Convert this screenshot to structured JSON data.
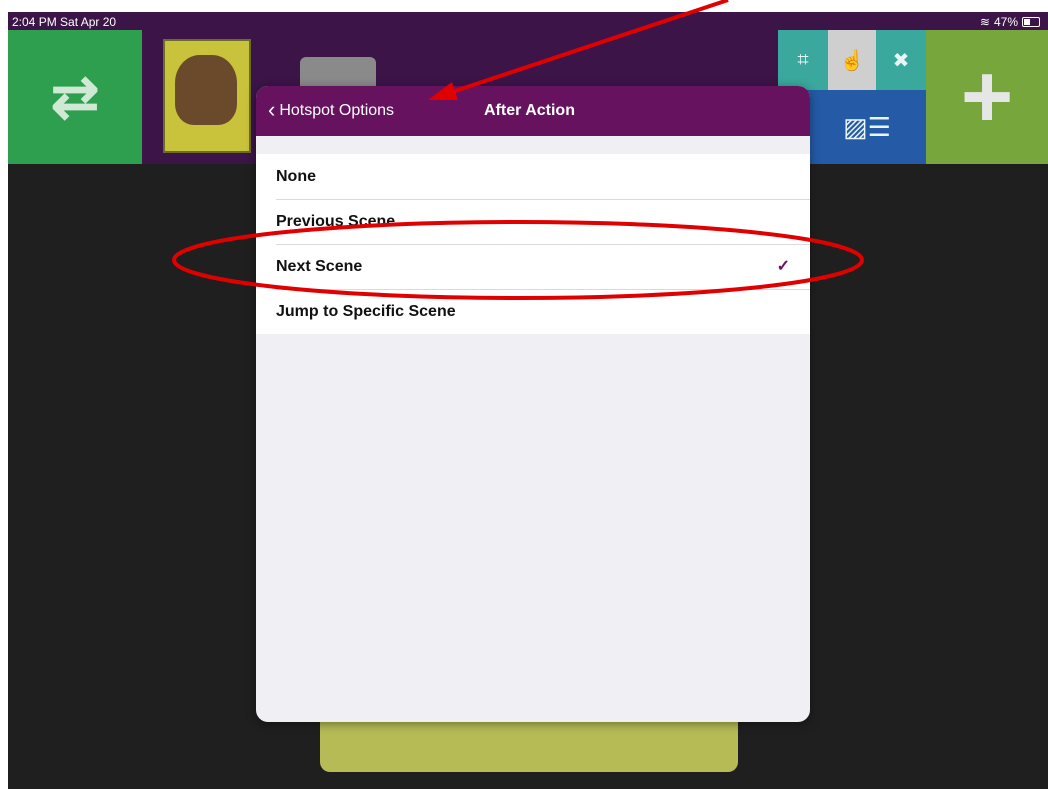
{
  "status_bar": {
    "time": "2:04 PM  Sat Apr 20",
    "battery": "47%",
    "wifi_icon": "wifi-icon"
  },
  "dialog": {
    "back_label": "Hotspot Options",
    "title": "After Action",
    "options": [
      {
        "label": "None",
        "selected": false
      },
      {
        "label": "Previous Scene",
        "selected": false
      },
      {
        "label": "Next Scene",
        "selected": true
      },
      {
        "label": "Jump to Specific Scene",
        "selected": false
      }
    ],
    "check_mark": "✓"
  },
  "colors": {
    "header": "#66125e",
    "annotation": "#e00000"
  }
}
